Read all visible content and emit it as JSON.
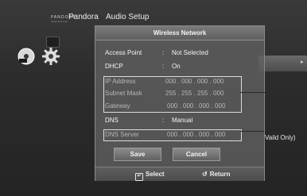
{
  "brand": {
    "logo": "PANDORA",
    "tagline": "music and more",
    "name": "Pandora"
  },
  "background_title": "Audio Setup",
  "dialog": {
    "title": "Wireless Network",
    "rows": [
      {
        "label": "Access Point",
        "value": "Not Selected"
      },
      {
        "label": "DHCP",
        "value": "On"
      },
      {
        "label": "IP Address",
        "value": "000 . 000 . 000 . 000"
      },
      {
        "label": "Subnet Mask",
        "value": "255 . 255 . 255 . 000"
      },
      {
        "label": "Gateway",
        "value": "000 . 000 . 000 . 000"
      },
      {
        "label": "DNS",
        "value": "Manual"
      },
      {
        "label": "DNS Server",
        "value": "000 . 000 . 000 . 000"
      }
    ],
    "colon": ":",
    "buttons": {
      "save": "Save",
      "cancel": "Cancel"
    },
    "footer": {
      "select": "Select",
      "return": "Return"
    }
  },
  "annotation": {
    "text": "Vaild Only)"
  }
}
